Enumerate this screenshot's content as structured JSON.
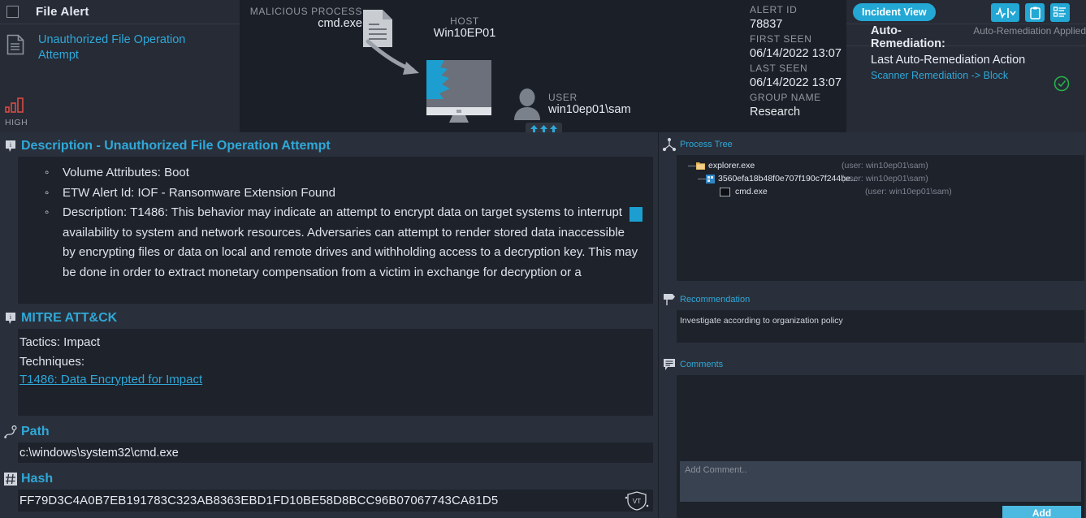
{
  "alert": {
    "type_label": "File Alert",
    "name": "Unauthorized File Operation Attempt",
    "severity": "HIGH",
    "severity_color": "#d94a42"
  },
  "graph": {
    "malicious_process_caption": "MALICIOUS PROCESS",
    "malicious_process_value": "cmd.exe",
    "host_caption": "HOST",
    "host_value": "Win10EP01",
    "user_caption": "USER",
    "user_value": "win10ep01\\sam"
  },
  "metadata": {
    "alert_id_caption": "ALERT ID",
    "alert_id_value": "78837",
    "first_seen_caption": "FIRST SEEN",
    "first_seen_value": "06/14/2022 13:07",
    "last_seen_caption": "LAST SEEN",
    "last_seen_value": "06/14/2022 13:07",
    "group_name_caption": "GROUP NAME",
    "group_name_value": "Research"
  },
  "remediation": {
    "incident_view_label": "Incident View",
    "auto_remediation_key": "Auto-Remediation:",
    "auto_remediation_value": "Auto-Remediation Applied",
    "last_action_title": "Last Auto-Remediation Action",
    "last_action_value": "Scanner Remediation -> Block",
    "status_color": "#27b34a"
  },
  "description": {
    "title": "Description - Unauthorized File Operation Attempt",
    "items": [
      "Volume Attributes: Boot",
      "ETW Alert Id: IOF - Ransomware Extension Found",
      "Description: T1486: This behavior may indicate an attempt to encrypt data on target systems to interrupt availability to system and network resources. Adversaries can attempt to render stored data inaccessible by encrypting files or data on local and remote drives and withholding access to a decryption key. This may be done in order to extract monetary compensation from a victim in exchange for decryption or a"
    ]
  },
  "mitre": {
    "title": "MITRE ATT&CK",
    "tactics_line": "Tactics: Impact",
    "techniques_line": "Techniques:",
    "technique_link": "T1486: Data Encrypted for Impact"
  },
  "path": {
    "title": "Path",
    "value": "c:\\windows\\system32\\cmd.exe"
  },
  "hash": {
    "title": "Hash",
    "value": "FF79D3C4A0B7EB191783C323AB8363EBD1FD10BE58D8BCC96B07067743CA81D5",
    "vt_label": "VT"
  },
  "process_tree": {
    "title": "Process Tree",
    "rows": [
      {
        "name": "explorer.exe",
        "user": "(user: win10ep01\\sam)",
        "depth": 0,
        "expander": "—",
        "icon": "folder-icon"
      },
      {
        "name": "3560efa18b48f0e707f190c7f244be...",
        "user": "(user: win10ep01\\sam)",
        "depth": 1,
        "expander": "—",
        "icon": "app-icon"
      },
      {
        "name": "cmd.exe",
        "user": "(user: win10ep01\\sam)",
        "depth": 2,
        "expander": "",
        "icon": "console-icon"
      }
    ]
  },
  "recommendation": {
    "title": "Recommendation",
    "text": "Investigate according to organization policy"
  },
  "comments": {
    "title": "Comments",
    "placeholder": "Add Comment..",
    "add_label": "Add"
  }
}
